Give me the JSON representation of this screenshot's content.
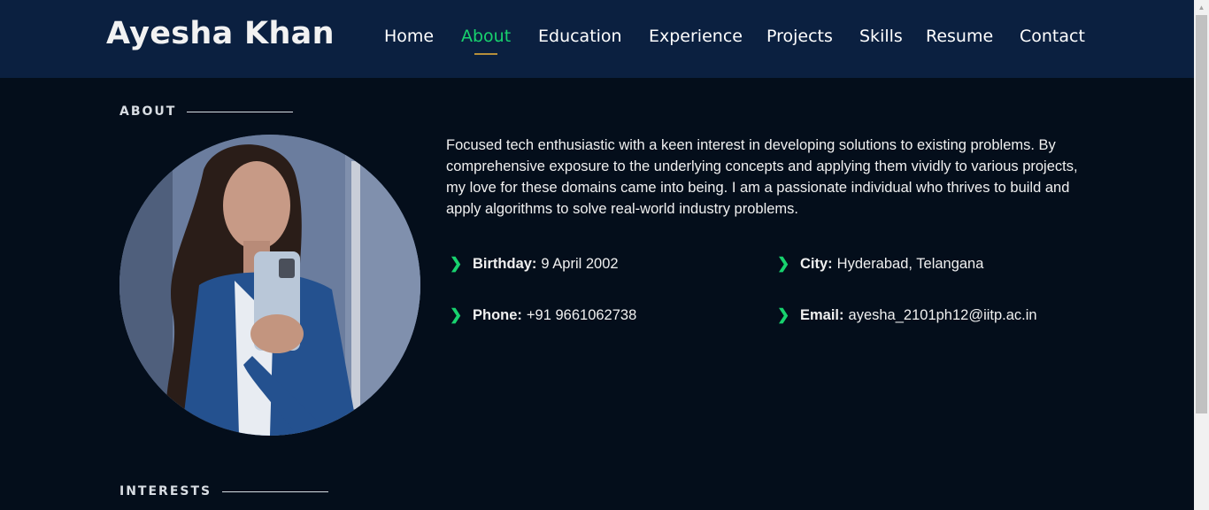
{
  "header": {
    "logo": "Ayesha Khan",
    "nav": [
      {
        "label": "Home",
        "active": false
      },
      {
        "label": "About",
        "active": true
      },
      {
        "label": "Education",
        "active": false
      },
      {
        "label": "Experience",
        "active": false
      },
      {
        "label": "Projects",
        "active": false
      },
      {
        "label": "Skills",
        "active": false
      },
      {
        "label": "Resume",
        "active": false
      },
      {
        "label": "Contact",
        "active": false
      }
    ]
  },
  "about": {
    "section_title": "ABOUT",
    "bio": "Focused tech enthusiastic with a keen interest in developing solutions to existing problems. By comprehensive exposure to the underlying concepts and applying them vividly to various projects, my love for these domains came into being. I am a passionate individual who thrives to build and apply algorithms to solve real-world industry problems.",
    "details": {
      "birthday": {
        "label": "Birthday:",
        "value": "9 April 2002"
      },
      "city": {
        "label": "City:",
        "value": "Hyderabad, Telangana"
      },
      "phone": {
        "label": "Phone:",
        "value": "+91 9661062738"
      },
      "email": {
        "label": "Email:",
        "value": "ayesha_2101ph12@iitp.ac.in"
      }
    }
  },
  "interests": {
    "section_title": "INTERESTS"
  },
  "colors": {
    "accent": "#18d26e",
    "header_bg": "#0b2040",
    "page_bg": "#040e1b"
  }
}
